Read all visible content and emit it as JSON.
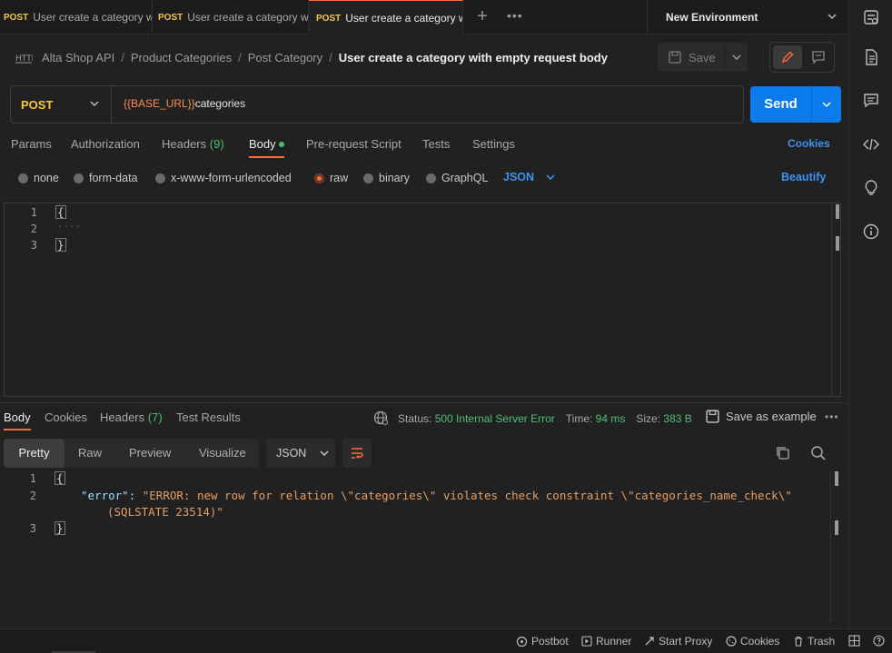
{
  "tabs": [
    {
      "method": "POST",
      "title": "User create a category w"
    },
    {
      "method": "POST",
      "title": "User create a category w"
    },
    {
      "method": "POST",
      "title": "User create a category w",
      "active": true
    }
  ],
  "environment": "New Environment",
  "breadcrumb": {
    "items": [
      "Alta Shop API",
      "Product Categories",
      "Post Category"
    ],
    "current": "User create a category with empty request body"
  },
  "toolbar": {
    "save_label": "Save"
  },
  "request": {
    "method": "POST",
    "url_var": "{{BASE_URL}}",
    "url_path": "categories",
    "send_label": "Send"
  },
  "request_tabs": {
    "params": "Params",
    "authorization": "Authorization",
    "headers": "Headers",
    "headers_count": "(9)",
    "body": "Body",
    "pre_request": "Pre-request Script",
    "tests": "Tests",
    "settings": "Settings",
    "cookies": "Cookies"
  },
  "body_types": {
    "none": "none",
    "form_data": "form-data",
    "urlencoded": "x-www-form-urlencoded",
    "raw": "raw",
    "binary": "binary",
    "graphql": "GraphQL",
    "language": "JSON",
    "beautify": "Beautify",
    "selected": "raw"
  },
  "request_body": {
    "line_numbers": [
      "1",
      "2",
      "3"
    ],
    "line1": "{",
    "line2": "····",
    "line3": "}"
  },
  "response_tabs": {
    "body": "Body",
    "cookies": "Cookies",
    "headers": "Headers",
    "headers_count": "(7)",
    "test_results": "Test Results"
  },
  "response_meta": {
    "status_label": "Status:",
    "status_value": "500 Internal Server Error",
    "time_label": "Time:",
    "time_value": "94 ms",
    "size_label": "Size:",
    "size_value": "383 B",
    "save_as_example": "Save as example"
  },
  "response_view": {
    "pretty": "Pretty",
    "raw": "Raw",
    "preview": "Preview",
    "visualize": "Visualize",
    "format": "JSON"
  },
  "response_body": {
    "line_numbers": [
      "1",
      "2",
      "3"
    ],
    "open": "{",
    "key": "\"error\"",
    "colon": ": ",
    "value_line1": "\"ERROR: new row for relation \\\"categories\\\" violates check constraint \\\"categories_name_check\\\"",
    "value_line2": "(SQLSTATE 23514)\"",
    "close": "}"
  },
  "status_bar": {
    "postbot": "Postbot",
    "runner": "Runner",
    "start_proxy": "Start Proxy",
    "cookies": "Cookies",
    "trash": "Trash"
  },
  "colors": {
    "accent": "#ff6c37",
    "primary": "#097bed",
    "success": "#4fbf73",
    "method_post": "#f2c744"
  }
}
